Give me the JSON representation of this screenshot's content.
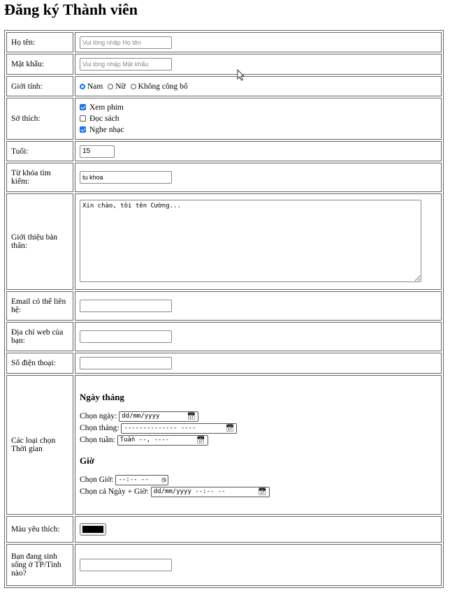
{
  "title": "Đăng ký Thành viên",
  "form": {
    "name": {
      "label": "Họ tên:",
      "placeholder": "Vui lòng nhập Họ tên"
    },
    "password": {
      "label": "Mật khẩu:",
      "placeholder": "Vui lòng nhập Mật khẩu"
    },
    "gender": {
      "label": "Giới tính:",
      "options": [
        "Nam",
        "Nữ",
        "Không công bố"
      ],
      "selected": "Nam"
    },
    "hobbies": {
      "label": "Sở thích:",
      "items": [
        {
          "label": "Xem phim",
          "checked": true
        },
        {
          "label": "Đọc sách",
          "checked": false
        },
        {
          "label": "Nghe nhạc",
          "checked": true
        }
      ]
    },
    "age": {
      "label": "Tuổi:",
      "value": "15"
    },
    "keyword": {
      "label": "Từ khóa tìm kiếm:",
      "value": "tu khoa"
    },
    "bio": {
      "label": "Giới thiệu bản thân:",
      "value": "Xin chào, tôi tên Cường..."
    },
    "email": {
      "label": "Email có thể liên hệ:"
    },
    "website": {
      "label": "Địa chỉ web của bạn:"
    },
    "phone": {
      "label": "Số điện thoại:"
    },
    "time": {
      "label": "Các loại chọn Thời gian",
      "date_heading": "Ngày tháng",
      "date_label": "Chọn ngày:",
      "date_value": "dd/mm/yyyy",
      "month_label": "Chọn tháng:",
      "month_value": "-------------- ----",
      "week_label": "Chọn tuần:",
      "week_value": "Tuần --, ----",
      "time_heading": "Giờ",
      "time_label": "Chọn Giờ:",
      "time_value": "--:-- --",
      "datetime_label": "Chọn cả Ngày + Giờ:",
      "datetime_value": "dd/mm/yyyy --:-- --"
    },
    "color": {
      "label": "Màu yêu thích:",
      "value": "#000000"
    },
    "city": {
      "label": "Bạn đang sinh sống ở TP/Tỉnh nào?"
    }
  }
}
